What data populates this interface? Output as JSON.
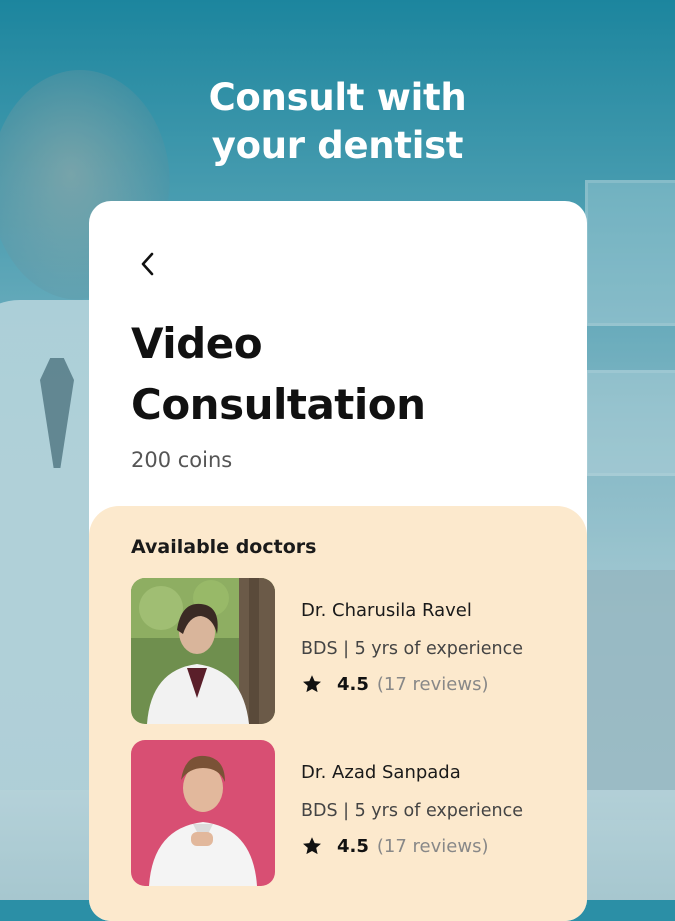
{
  "headline": {
    "line1": "Consult with",
    "line2": "your dentist"
  },
  "card": {
    "title_line1": "Video",
    "title_line2": "Consultation",
    "price": "200 coins",
    "back_icon": "chevron-left-icon",
    "doctors_heading": "Available doctors",
    "doctors": [
      {
        "name": "Dr. Charusila Ravel",
        "meta": "BDS | 5 yrs of experience",
        "rating": "4.5",
        "reviews": "(17 reviews)"
      },
      {
        "name": "Dr. Azad Sanpada",
        "meta": "BDS | 5 yrs of experience",
        "rating": "4.5",
        "reviews": "(17 reviews)"
      }
    ]
  },
  "colors": {
    "brand_teal": "#2b8fa6",
    "panel": "#fce9cd",
    "card": "#ffffff"
  }
}
